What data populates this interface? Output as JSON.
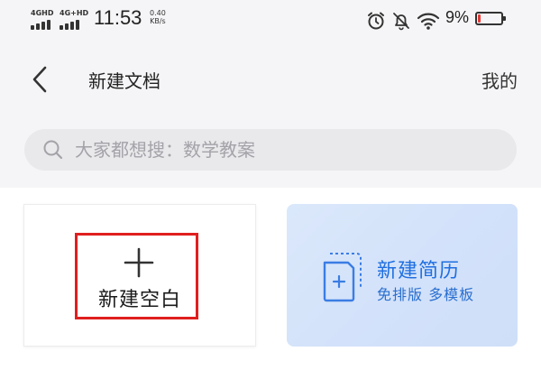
{
  "status_bar": {
    "sim1_label": "4GHD",
    "sim2_label": "4G+HD",
    "time": "11:53",
    "net_speed_value": "0.40",
    "net_speed_unit": "KB/s",
    "battery_percent": "9%",
    "battery_level": 0.09,
    "battery_color": "#e53935",
    "icons": [
      "alarm-icon",
      "mute-bell-icon",
      "wifi-icon",
      "battery-icon"
    ]
  },
  "nav": {
    "title": "新建文档",
    "mine_label": "我的",
    "back_icon": "chevron-left-icon"
  },
  "search": {
    "placeholder": "大家都想搜：数学教案",
    "value": "",
    "icon": "search-icon"
  },
  "cards": {
    "blank": {
      "label": "新建空白",
      "icon": "plus-icon",
      "highlight_color": "#e01f1f"
    },
    "resume": {
      "title": "新建简历",
      "subtitle": "免排版 多模板",
      "icon": "resume-doc-icon",
      "accent_color": "#1f6fe0"
    }
  }
}
